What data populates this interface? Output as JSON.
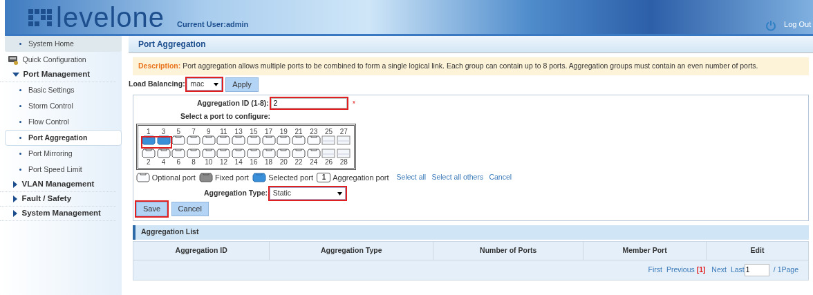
{
  "header": {
    "logo": "levelone",
    "current_user": "Current User:admin",
    "logout": "Log Out"
  },
  "sidebar": [
    {
      "kind": "link",
      "label": "System Home",
      "selected": false,
      "hover": true
    },
    {
      "kind": "icon",
      "label": "Quick Configuration",
      "selected": false
    },
    {
      "kind": "group",
      "label": "Port Management",
      "expanded": true,
      "children": [
        {
          "kind": "link",
          "label": "Basic Settings",
          "selected": false
        },
        {
          "kind": "link",
          "label": "Storm Control",
          "selected": false
        },
        {
          "kind": "link",
          "label": "Flow Control",
          "selected": false
        },
        {
          "kind": "link",
          "label": "Port Aggregation",
          "selected": true
        },
        {
          "kind": "link",
          "label": "Port Mirroring",
          "selected": false
        },
        {
          "kind": "link",
          "label": "Port Speed Limit",
          "selected": false
        }
      ]
    },
    {
      "kind": "group",
      "label": "VLAN Management",
      "expanded": false
    },
    {
      "kind": "group",
      "label": "Fault / Safety",
      "expanded": false
    },
    {
      "kind": "group",
      "label": "System Management",
      "expanded": false
    }
  ],
  "page_title": "Port Aggregation",
  "description": {
    "label": "Description:",
    "text": "Port aggregation allows multiple ports to be combined to form a single logical link. Each group can contain up to 8 ports. Aggregation groups must contain an even number of ports."
  },
  "load_balancing": {
    "label": "Load Balancing:",
    "value": "mac",
    "highlighted": true,
    "apply": "Apply"
  },
  "aggregation_id": {
    "label": "Aggregation ID (1-8):",
    "value": "2",
    "required": "*",
    "highlighted": true
  },
  "port_prompt": "Select a port to configure:",
  "port_columns": [
    {
      "top": {
        "label": "1",
        "kind": "rj45",
        "selected": true
      },
      "bottom": {
        "label": "2",
        "kind": "rj45",
        "selected": false
      }
    },
    {
      "top": {
        "label": "3",
        "kind": "rj45",
        "selected": true
      },
      "bottom": {
        "label": "4",
        "kind": "rj45",
        "selected": false
      }
    },
    {
      "top": {
        "label": "5",
        "kind": "rj45",
        "selected": false
      },
      "bottom": {
        "label": "6",
        "kind": "rj45",
        "selected": false
      }
    },
    {
      "top": {
        "label": "7",
        "kind": "rj45",
        "selected": false
      },
      "bottom": {
        "label": "8",
        "kind": "rj45",
        "selected": false
      }
    },
    {
      "top": {
        "label": "9",
        "kind": "rj45",
        "selected": false
      },
      "bottom": {
        "label": "10",
        "kind": "rj45",
        "selected": false
      }
    },
    {
      "top": {
        "label": "11",
        "kind": "rj45",
        "selected": false
      },
      "bottom": {
        "label": "12",
        "kind": "rj45",
        "selected": false
      }
    },
    {
      "top": {
        "label": "13",
        "kind": "rj45",
        "selected": false
      },
      "bottom": {
        "label": "14",
        "kind": "rj45",
        "selected": false
      }
    },
    {
      "top": {
        "label": "15",
        "kind": "rj45",
        "selected": false
      },
      "bottom": {
        "label": "16",
        "kind": "rj45",
        "selected": false
      }
    },
    {
      "top": {
        "label": "17",
        "kind": "rj45",
        "selected": false
      },
      "bottom": {
        "label": "18",
        "kind": "rj45",
        "selected": false
      }
    },
    {
      "top": {
        "label": "19",
        "kind": "rj45",
        "selected": false
      },
      "bottom": {
        "label": "20",
        "kind": "rj45",
        "selected": false
      }
    },
    {
      "top": {
        "label": "21",
        "kind": "rj45",
        "selected": false
      },
      "bottom": {
        "label": "22",
        "kind": "rj45",
        "selected": false
      }
    },
    {
      "top": {
        "label": "23",
        "kind": "rj45",
        "selected": false
      },
      "bottom": {
        "label": "24",
        "kind": "rj45",
        "selected": false
      }
    },
    {
      "top": {
        "label": "25",
        "kind": "sfp",
        "selected": false
      },
      "bottom": {
        "label": "26",
        "kind": "sfp",
        "selected": false
      }
    },
    {
      "top": {
        "label": "27",
        "kind": "sfp",
        "selected": false
      },
      "bottom": {
        "label": "28",
        "kind": "sfp",
        "selected": false
      }
    }
  ],
  "legend": [
    {
      "kind": "optional",
      "label": "Optional port"
    },
    {
      "kind": "fixed",
      "label": "Fixed port"
    },
    {
      "kind": "selected",
      "label": "Selected port"
    },
    {
      "kind": "aggregation",
      "badge": "1",
      "label": "Aggregation port"
    }
  ],
  "port_links": [
    "Select all",
    "Select all others",
    "Cancel"
  ],
  "aggregation_type": {
    "label": "Aggregation Type:",
    "value": "Static",
    "highlighted": true
  },
  "buttons": [
    {
      "label": "Save",
      "highlighted": true
    },
    {
      "label": "Cancel",
      "highlighted": false
    }
  ],
  "list": {
    "title": "Aggregation List",
    "columns": [
      "Aggregation ID",
      "Aggregation Type",
      "Number of Ports",
      "Member Port",
      "Edit"
    ]
  },
  "pagination": {
    "first": "First",
    "previous": "Previous",
    "current": "[1]",
    "next": "Next",
    "last": "Last",
    "page_input": "1",
    "total": "/ 1Page"
  }
}
